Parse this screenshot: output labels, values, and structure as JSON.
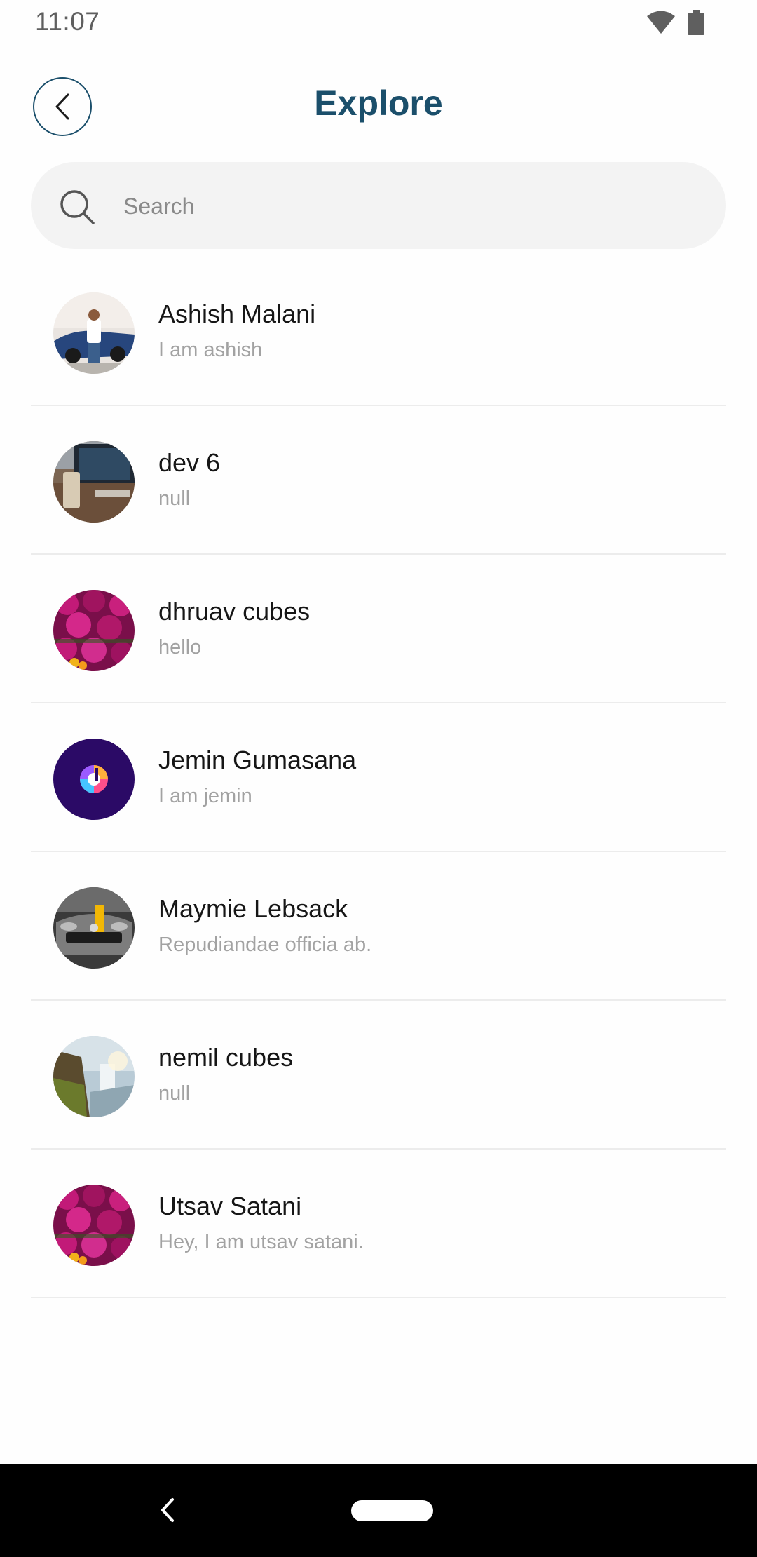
{
  "status_bar": {
    "time": "11:07",
    "icons": [
      "wifi-icon",
      "battery-icon"
    ]
  },
  "header": {
    "title": "Explore",
    "back_icon": "chevron-left-icon"
  },
  "search": {
    "placeholder": "Search",
    "value": "",
    "icon": "search-icon"
  },
  "users": [
    {
      "name": "Ashish Malani",
      "bio": "I am ashish"
    },
    {
      "name": "dev 6",
      "bio": "null"
    },
    {
      "name": "dhruav cubes",
      "bio": "hello"
    },
    {
      "name": "Jemin Gumasana",
      "bio": "I am jemin"
    },
    {
      "name": "Maymie Lebsack",
      "bio": "Repudiandae officia ab."
    },
    {
      "name": "nemil cubes",
      "bio": "null"
    },
    {
      "name": "Utsav Satani",
      "bio": "Hey, I am utsav satani."
    }
  ],
  "nav_bar": {
    "back_icon": "nav-back-icon",
    "home_icon": "home-pill-icon"
  },
  "colors": {
    "accent": "#1b4f6b",
    "search_bg": "#f3f3f3",
    "divider": "#ececec",
    "bio_text": "#a2a2a2"
  }
}
